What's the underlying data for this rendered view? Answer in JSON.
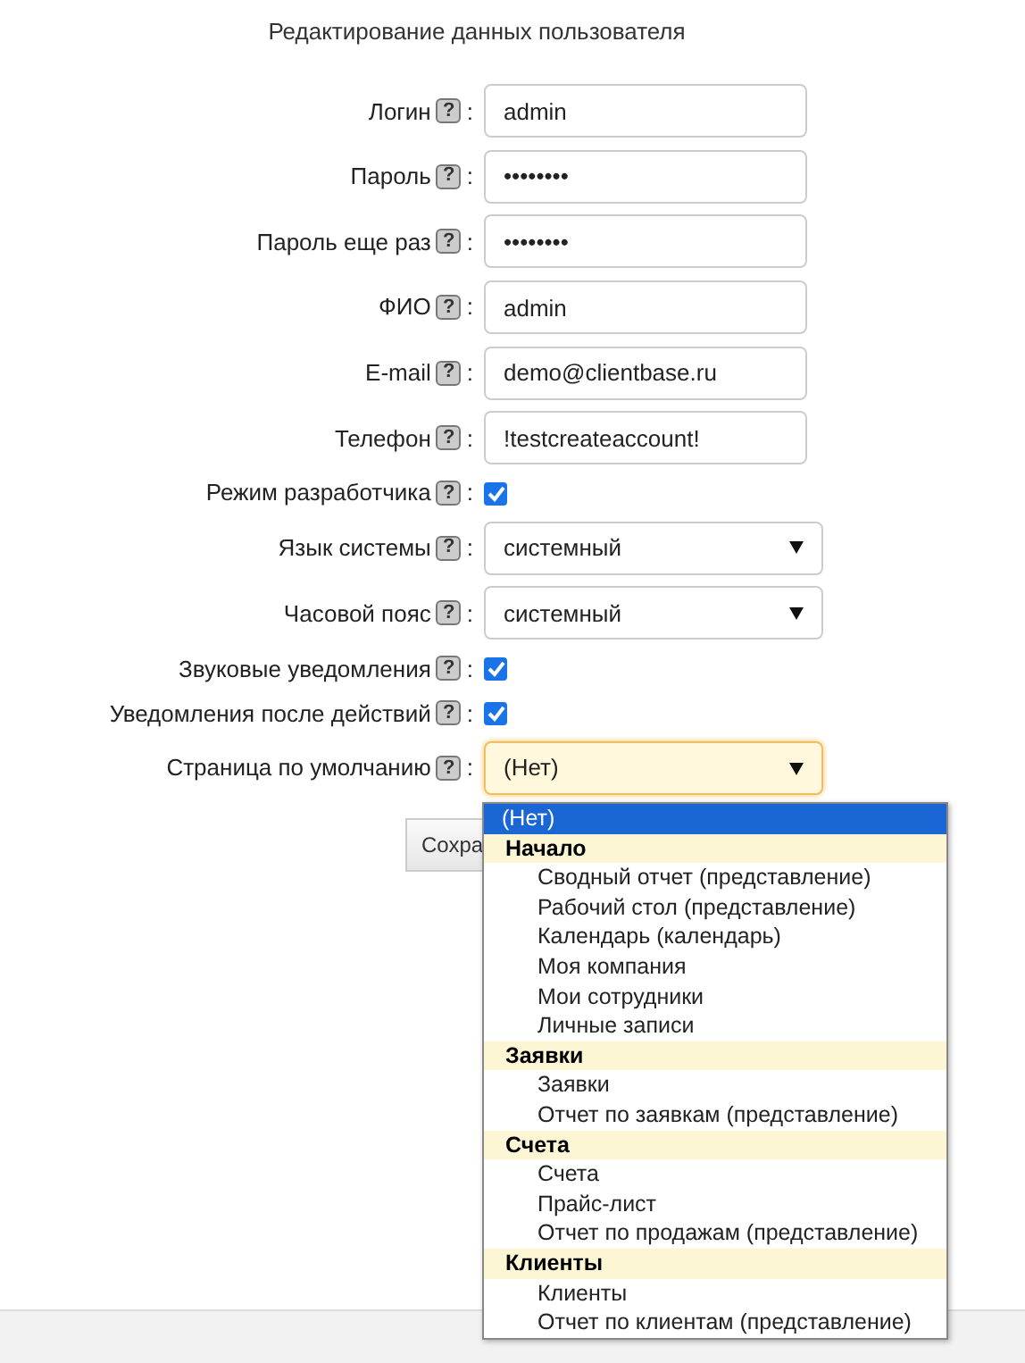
{
  "title": "Редактирование данных пользователя",
  "fields": [
    {
      "kind": "text",
      "label": "Логин",
      "help": "?",
      "suffix": ":",
      "value": "admin"
    },
    {
      "kind": "text",
      "label": "Пароль",
      "help": "?",
      "suffix": ":",
      "value": "••••••••"
    },
    {
      "kind": "text",
      "label": "Пароль еще раз",
      "help": "?",
      "suffix": ":",
      "value": "••••••••"
    },
    {
      "kind": "text",
      "label": "ФИО",
      "help": "?",
      "suffix": ":",
      "value": "admin"
    },
    {
      "kind": "text",
      "label": "E-mail",
      "help": "?",
      "suffix": ":",
      "value": "demo@clientbase.ru"
    },
    {
      "kind": "text",
      "label": "Телефон",
      "help": "?",
      "suffix": ":",
      "value": "!testcreateaccount!"
    },
    {
      "kind": "checkbox",
      "label": "Режим разработчика",
      "help": "?",
      "suffix": ":",
      "checked": true
    },
    {
      "kind": "select",
      "label": "Язык системы",
      "help": "?",
      "suffix": ":",
      "value": "системный",
      "focused": false
    },
    {
      "kind": "select",
      "label": "Часовой пояс",
      "help": "?",
      "suffix": ":",
      "value": "системный",
      "focused": false
    },
    {
      "kind": "checkbox",
      "label": "Звуковые уведомления",
      "help": "?",
      "suffix": ":",
      "checked": true
    },
    {
      "kind": "checkbox",
      "label": "Уведомления после действий",
      "help": "?",
      "suffix": ":",
      "checked": true
    },
    {
      "kind": "select",
      "label": "Страница по умолчанию",
      "help": "?",
      "suffix": ":",
      "value": "(Нет)",
      "focused": true
    }
  ],
  "save_button": {
    "label": "Сохра"
  },
  "dropdown": {
    "options": [
      {
        "kind": "option",
        "label": "(Нет)",
        "selected": true
      },
      {
        "kind": "group",
        "label": "Начало"
      },
      {
        "kind": "option",
        "label": "Сводный отчет (представление)",
        "selected": false
      },
      {
        "kind": "option",
        "label": "Рабочий стол (представление)",
        "selected": false
      },
      {
        "kind": "option",
        "label": "Календарь (календарь)",
        "selected": false
      },
      {
        "kind": "option",
        "label": "Моя компания",
        "selected": false
      },
      {
        "kind": "option",
        "label": "Мои сотрудники",
        "selected": false
      },
      {
        "kind": "option",
        "label": "Личные записи",
        "selected": false
      },
      {
        "kind": "group",
        "label": "Заявки"
      },
      {
        "kind": "option",
        "label": "Заявки",
        "selected": false
      },
      {
        "kind": "option",
        "label": "Отчет по заявкам (представление)",
        "selected": false
      },
      {
        "kind": "group",
        "label": "Счета"
      },
      {
        "kind": "option",
        "label": "Счета",
        "selected": false
      },
      {
        "kind": "option",
        "label": "Прайс-лист",
        "selected": false
      },
      {
        "kind": "option",
        "label": "Отчет по продажам (представление)",
        "selected": false
      },
      {
        "kind": "group",
        "label": "Клиенты"
      },
      {
        "kind": "option",
        "label": "Клиенты",
        "selected": false
      },
      {
        "kind": "option",
        "label": "Отчет по клиентам (представление)",
        "selected": false
      }
    ]
  }
}
